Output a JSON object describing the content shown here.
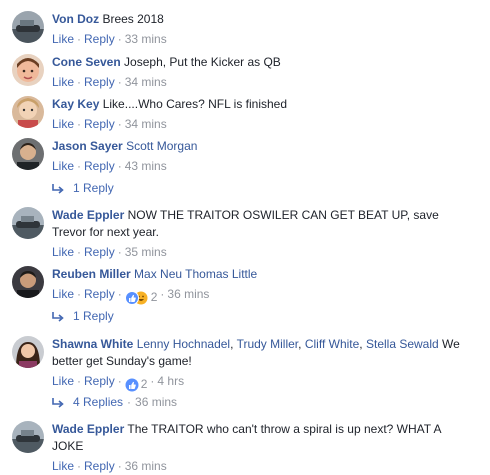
{
  "ui": {
    "like": "Like",
    "reply": "Reply",
    "dot": "·"
  },
  "colors": {
    "link": "#365899",
    "action": "#4267b2",
    "muted": "#90949c",
    "like_blue": "#5890ff",
    "haha_yellow": "#f7b125"
  },
  "comments": [
    {
      "author": "Von Doz",
      "text": "Brees 2018",
      "time": "33 mins"
    },
    {
      "author": "Cone Seven",
      "text": "Joseph, Put the Kicker as QB",
      "time": "34 mins"
    },
    {
      "author": "Kay Key",
      "text": "Like....Who Cares? NFL is finished",
      "time": "34 mins"
    },
    {
      "author": "Jason Sayer",
      "mention": "Scott Morgan",
      "time": "43 mins",
      "replies": "1 Reply"
    },
    {
      "author": "Wade Eppler",
      "text_line1": "NOW THE TRAITOR OSWILER CAN GET BEAT UP, save",
      "text_line2": "Trevor for next year.",
      "time": "35 mins"
    },
    {
      "author": "Reuben Miller",
      "mention": "Max Neu Thomas Little",
      "reactions": "2",
      "time": "36 mins",
      "replies": "1 Reply"
    },
    {
      "author": "Shawna White",
      "mentions": [
        "Lenny Hochnadel",
        "Trudy Miller",
        "Cliff White",
        "Stella Sewald"
      ],
      "comma": ",",
      "text_tail": "We",
      "text_line2": "better get Sunday's game!",
      "reactions": "2",
      "time": "4 hrs",
      "replies": "4 Replies",
      "replies_time": "36 mins"
    },
    {
      "author": "Wade Eppler",
      "text_line1": "The TRAITOR who can't throw a spiral is up next? WHAT A",
      "text_line2": "JOKE",
      "time": "36 mins"
    }
  ]
}
